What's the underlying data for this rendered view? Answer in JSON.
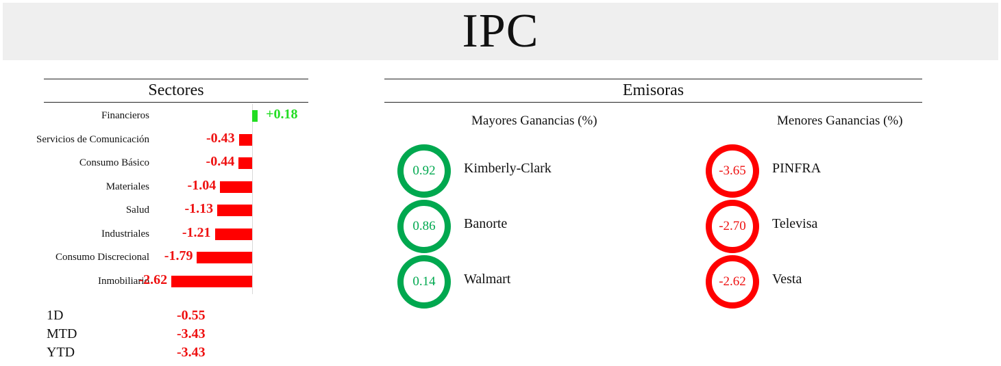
{
  "title": "IPC",
  "sectores": {
    "title": "Sectores",
    "items": [
      {
        "label": "Financieros",
        "value": 0.18,
        "display": "+0.18"
      },
      {
        "label": "Servicios de Comunicación",
        "value": -0.43,
        "display": "-0.43"
      },
      {
        "label": "Consumo Básico",
        "value": -0.44,
        "display": "-0.44"
      },
      {
        "label": "Materiales",
        "value": -1.04,
        "display": "-1.04"
      },
      {
        "label": "Salud",
        "value": -1.13,
        "display": "-1.13"
      },
      {
        "label": "Industriales",
        "value": -1.21,
        "display": "-1.21"
      },
      {
        "label": "Consumo Discrecional",
        "value": -1.79,
        "display": "-1.79"
      },
      {
        "label": "Inmobiliario",
        "value": -2.62,
        "display": "-2.62"
      }
    ]
  },
  "performance": [
    {
      "label": "1D",
      "value": "-0.55"
    },
    {
      "label": "MTD",
      "value": "-3.43"
    },
    {
      "label": "YTD",
      "value": "-3.43"
    }
  ],
  "emisoras": {
    "title": "Emisoras",
    "gainers_title": "Mayores Ganancias (%)",
    "losers_title": "Menores Ganancias (%)",
    "gainers": [
      {
        "name": "Kimberly-Clark",
        "value": "0.92"
      },
      {
        "name": "Banorte",
        "value": "0.86"
      },
      {
        "name": "Walmart",
        "value": "0.14"
      }
    ],
    "losers": [
      {
        "name": "PINFRA",
        "value": "-3.65"
      },
      {
        "name": "Televisa",
        "value": "-2.70"
      },
      {
        "name": "Vesta",
        "value": "-2.62"
      }
    ]
  },
  "colors": {
    "positive_bar": "#22dd22",
    "negative_bar": "#ff0000",
    "gain_ring": "#00a84f",
    "loss_ring": "#ff0000",
    "header_bg": "#efefef"
  }
}
